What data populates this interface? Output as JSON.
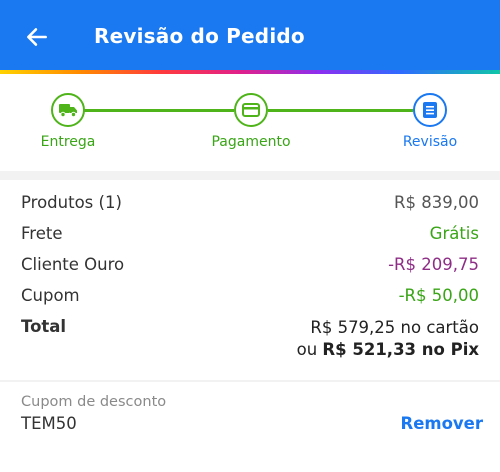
{
  "header": {
    "title": "Revisão do Pedido",
    "back_icon": "arrow-left-icon",
    "color": "#1a78f0"
  },
  "stepper": {
    "steps": [
      {
        "label": "Entrega",
        "icon": "truck-icon",
        "state": "done"
      },
      {
        "label": "Pagamento",
        "icon": "credit-card-icon",
        "state": "done"
      },
      {
        "label": "Revisão",
        "icon": "receipt-icon",
        "state": "current"
      }
    ],
    "done_color": "#4fb41a",
    "current_color": "#1a78f0"
  },
  "summary": {
    "products": {
      "label": "Produtos (1)",
      "value": "R$ 839,00"
    },
    "shipping": {
      "label": "Frete",
      "value": "Grátis"
    },
    "gold_client": {
      "label": "Cliente Ouro",
      "value": "-R$ 209,75"
    },
    "coupon": {
      "label": "Cupom",
      "value": "-R$ 50,00"
    },
    "total": {
      "label": "Total",
      "card_line": "R$ 579,25 no cartão",
      "pix_prefix": "ou",
      "pix_value": "R$ 521,33 no Pix"
    },
    "colors": {
      "green": "#3aa517",
      "purple": "#8e2d86"
    }
  },
  "coupon_box": {
    "caption": "Cupom de desconto",
    "code": "TEM50",
    "remove_label": "Remover"
  }
}
